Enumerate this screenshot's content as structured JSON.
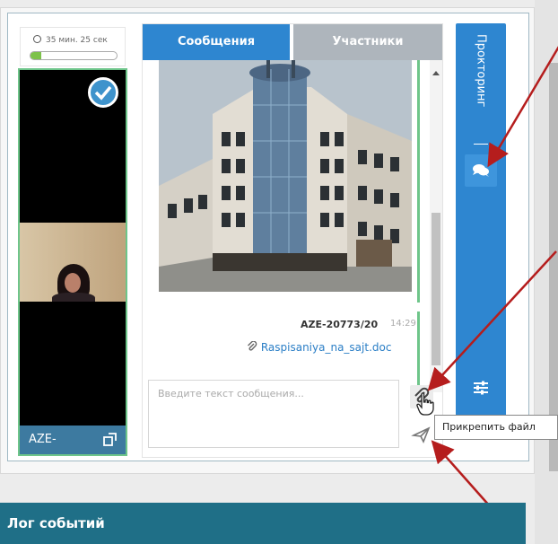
{
  "timer": {
    "text": "35 мин. 25 сек",
    "progress_percent": 12,
    "icon": "clock-icon"
  },
  "video": {
    "label": "AZE-",
    "status_icon": "check-icon",
    "action_icon": "expand-icon"
  },
  "chat": {
    "tabs": [
      {
        "label": "Сообщения",
        "active": true
      },
      {
        "label": "Участники",
        "active": false
      }
    ],
    "message": {
      "sender": "AZE-20773/20",
      "time": "14:29",
      "attachment": "Raspisaniya_na_sajt.doc"
    },
    "compose_placeholder": "Введите текст сообщения...",
    "attach_icon": "paperclip-icon",
    "send_icon": "send-icon"
  },
  "proctoring": {
    "title": "Прокторинг",
    "chat_icon": "chat-bubble-icon",
    "settings_icon": "sliders-icon"
  },
  "tooltip": {
    "text": "Прикрепить файл"
  },
  "events_log": {
    "title": "Лог событий"
  },
  "colors": {
    "primary": "#2e86d0",
    "tab_inactive": "#aeb5bc",
    "online": "#6ec58a",
    "events_bar": "#1f6f87",
    "annotation_arrow": "#b51d1d"
  }
}
